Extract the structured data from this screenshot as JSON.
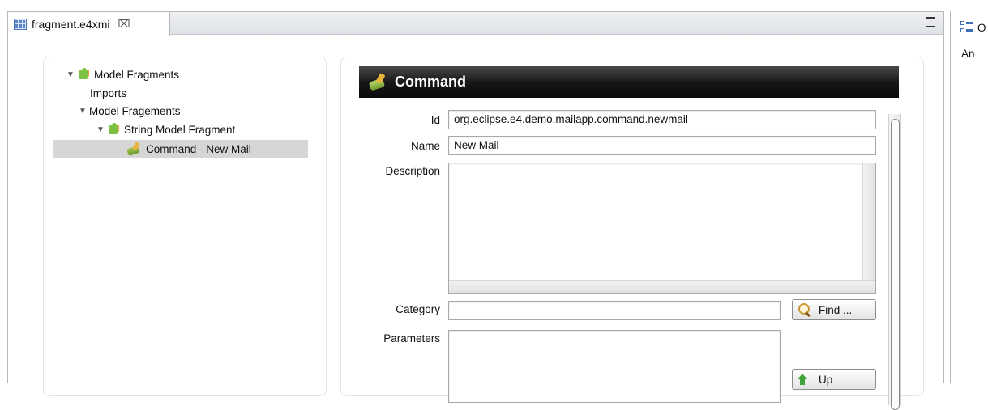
{
  "editor": {
    "tab_label": "fragment.e4xmi",
    "tab_close": "⌧"
  },
  "tree": {
    "items": [
      {
        "label": "Model Fragments",
        "level": 0,
        "expanded": true,
        "icon": "fragment-icon"
      },
      {
        "label": "Imports",
        "level": 1,
        "icon": "none"
      },
      {
        "label": "Model Fragements",
        "level": 1,
        "expanded": true,
        "icon": "none"
      },
      {
        "label": "String Model Fragment",
        "level": 2,
        "expanded": true,
        "icon": "fragment-icon"
      },
      {
        "label": "Command - New Mail",
        "level": 3,
        "icon": "command-icon",
        "selected": true
      }
    ]
  },
  "details": {
    "title": "Command",
    "fields": {
      "id_label": "Id",
      "id_value": "org.eclipse.e4.demo.mailapp.command.newmail",
      "name_label": "Name",
      "name_value": "New Mail",
      "description_label": "Description",
      "description_value": "",
      "category_label": "Category",
      "category_value": "",
      "parameters_label": "Parameters"
    },
    "buttons": {
      "find": "Find ...",
      "up": "Up"
    }
  },
  "outline": {
    "title": "O",
    "text": "An"
  },
  "colors": {
    "header_bg": "#161616",
    "header_text": "#ffffff",
    "selection": "#d6d6d6"
  }
}
